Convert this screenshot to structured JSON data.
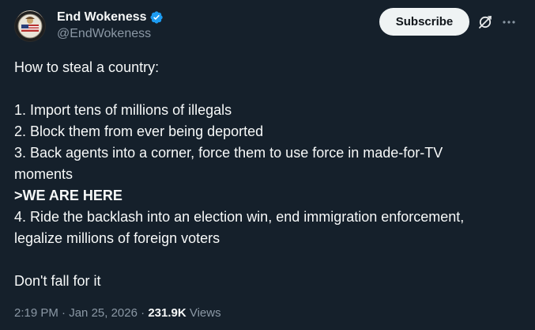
{
  "author": {
    "display_name": "End Wokeness",
    "handle": "@EndWokeness",
    "verified": true,
    "verified_color": "#1d9bf0"
  },
  "header": {
    "subscribe_label": "Subscribe",
    "icons": [
      "grok-icon",
      "more-options-icon"
    ]
  },
  "post": {
    "lines": [
      "How to steal a country:",
      "",
      "1. Import tens of millions of illegals",
      "2. Block them from ever being deported",
      "3. Back agents into a corner, force them to use force in made-for-TV",
      "moments",
      ">WE ARE HERE",
      "4. Ride the backlash into an election win, end immigration enforcement,",
      "legalize millions of foreign voters",
      "",
      "Don't fall for it"
    ]
  },
  "meta": {
    "time": "2:19 PM",
    "separator": "·",
    "date": "Jan 25, 2026",
    "views_count": "231.9K",
    "views_label": "Views"
  },
  "colors": {
    "background": "#15202b",
    "text_primary": "#f7f9f9",
    "text_secondary": "#8b98a5",
    "button_bg": "#eff3f4"
  }
}
